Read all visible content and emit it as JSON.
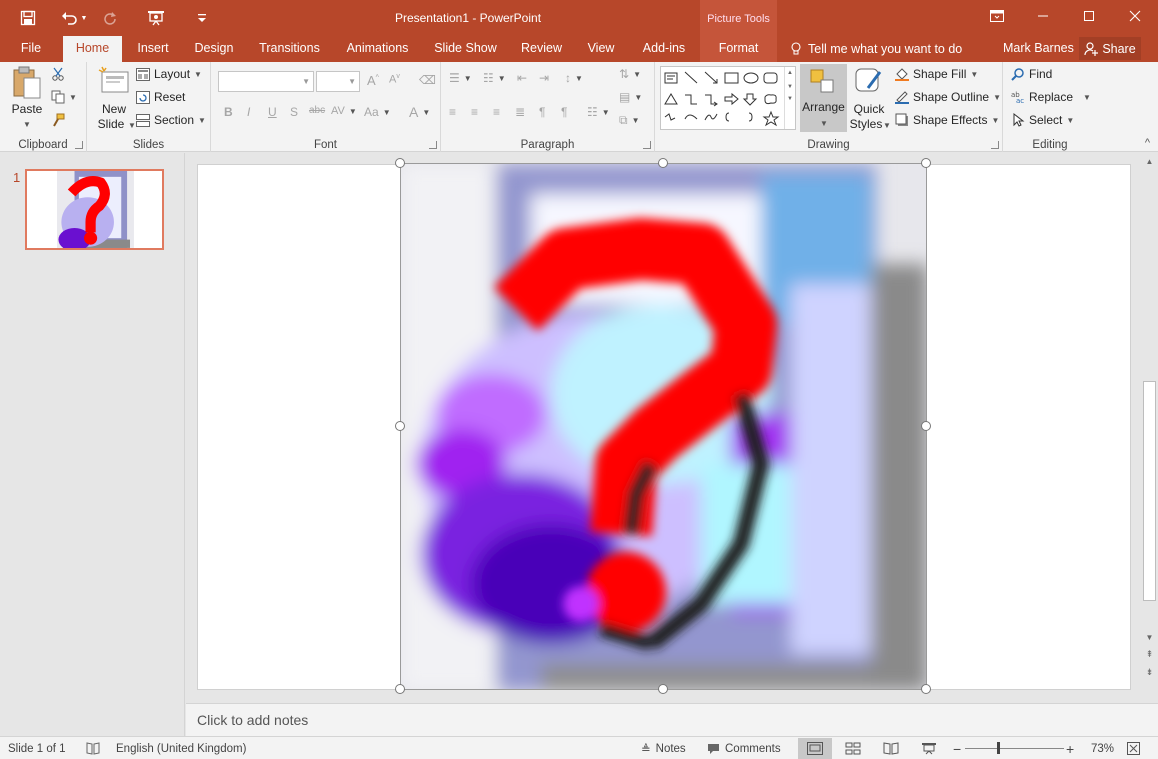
{
  "window": {
    "title": "Presentation1 - PowerPoint",
    "context_group": "Picture Tools",
    "controls": [
      "ribbon-display",
      "minimize",
      "maximize",
      "close"
    ]
  },
  "qat": {
    "items": [
      "save-icon",
      "undo-icon",
      "redo-icon",
      "present-icon",
      "customize-icon"
    ]
  },
  "tabs": {
    "file": "File",
    "home": "Home",
    "insert": "Insert",
    "design": "Design",
    "transitions": "Transitions",
    "animations": "Animations",
    "slideshow": "Slide Show",
    "review": "Review",
    "view": "View",
    "addins": "Add-ins",
    "format": "Format",
    "active": "Home"
  },
  "tellme": {
    "placeholder": "Tell me what you want to do"
  },
  "user": {
    "name": "Mark Barnes",
    "share": "Share"
  },
  "ribbon": {
    "clipboard": {
      "label": "Clipboard",
      "paste": "Paste"
    },
    "slides": {
      "label": "Slides",
      "new_slide_1": "New",
      "new_slide_2": "Slide",
      "layout": "Layout",
      "reset": "Reset",
      "section": "Section"
    },
    "font": {
      "label": "Font",
      "bold": "B",
      "italic": "I",
      "underline": "U",
      "shadow": "S",
      "strike": "abc",
      "spacing": "AV",
      "case": "Aa",
      "color": "A"
    },
    "paragraph": {
      "label": "Paragraph"
    },
    "drawing": {
      "label": "Drawing",
      "arrange": "Arrange",
      "quick_styles_1": "Quick",
      "quick_styles_2": "Styles",
      "shape_fill": "Shape Fill",
      "shape_outline": "Shape Outline",
      "shape_effects": "Shape Effects"
    },
    "editing": {
      "label": "Editing",
      "find": "Find",
      "replace": "Replace",
      "select": "Select"
    }
  },
  "thumbnails": [
    {
      "number": "1",
      "selected": true
    }
  ],
  "notes": {
    "placeholder": "Click to add notes"
  },
  "status": {
    "slide": "Slide 1 of 1",
    "language": "English (United Kingdom)",
    "notes": "Notes",
    "comments": "Comments",
    "zoom": "73%"
  },
  "colors": {
    "accent": "#b7472a",
    "ribbon_bg": "#f3f3f3",
    "workspace_bg": "#e6e6e6"
  }
}
